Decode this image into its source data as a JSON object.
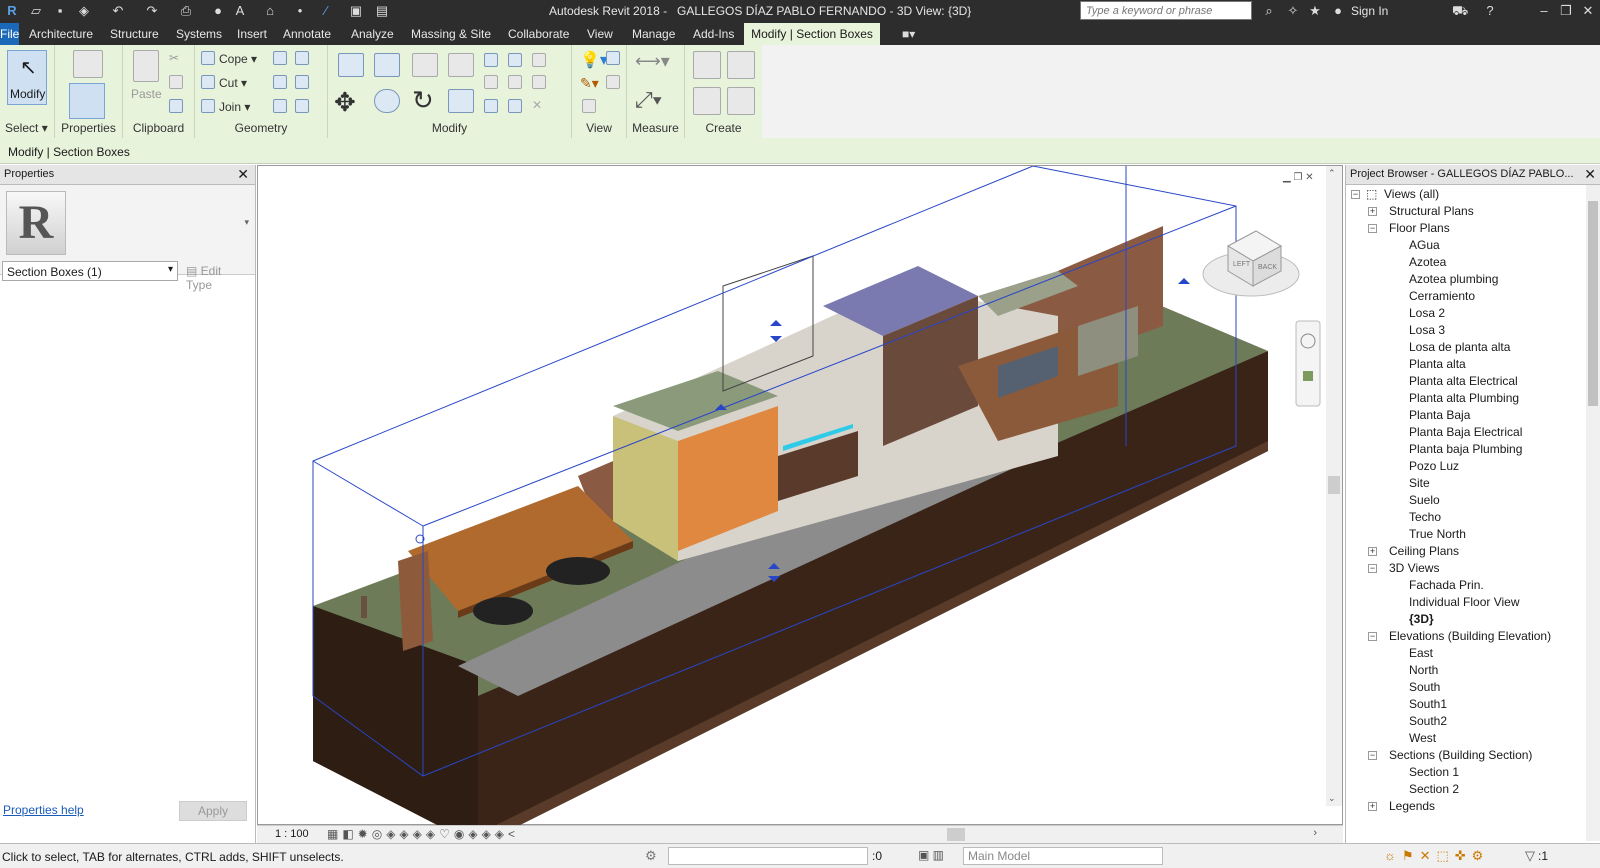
{
  "title": {
    "app": "Autodesk Revit 2018 -",
    "doc": "GALLEGOS DÍAZ PABLO FERNANDO - 3D View: {3D}",
    "search_placeholder": "Type a keyword or phrase",
    "sign_in": "Sign In"
  },
  "menu": {
    "tabs": [
      "File",
      "Architecture",
      "Structure",
      "Systems",
      "Insert",
      "Annotate",
      "Analyze",
      "Massing & Site",
      "Collaborate",
      "View",
      "Manage",
      "Add-Ins",
      "Modify | Section Boxes"
    ]
  },
  "ribbon": {
    "modify": "Modify",
    "properties": "Properties",
    "paste": "Paste",
    "cope": "Cope",
    "cut": "Cut",
    "join": "Join",
    "panels": {
      "select": "Select",
      "properties": "Properties",
      "clipboard": "Clipboard",
      "geometry": "Geometry",
      "modify": "Modify",
      "view": "View",
      "measure": "Measure",
      "create": "Create"
    }
  },
  "options_bar": "Modify | Section Boxes",
  "properties_panel": {
    "header": "Properties",
    "selector": "Section Boxes (1)",
    "edit_type": "Edit Type",
    "help": "Properties help",
    "apply": "Apply",
    "logo": "R"
  },
  "view": {
    "scale": "1 : 100",
    "viewcube": {
      "left": "LEFT",
      "back": "BACK"
    }
  },
  "project_browser": {
    "header": "Project Browser - GALLEGOS DÍAZ PABLO...",
    "root": "Views (all)",
    "groups": [
      {
        "label": "Structural Plans",
        "expanded": false,
        "items": []
      },
      {
        "label": "Floor Plans",
        "expanded": true,
        "items": [
          "AGua",
          "Azotea",
          "Azotea plumbing",
          "Cerramiento",
          "Losa 2",
          "Losa 3",
          "Losa de planta alta",
          "Planta alta",
          "Planta alta Electrical",
          "Planta alta Plumbing",
          "Planta Baja",
          "Planta Baja Electrical",
          "Planta baja Plumbing",
          "Pozo Luz",
          "Site",
          "Suelo",
          "Techo",
          "True North"
        ]
      },
      {
        "label": "Ceiling Plans",
        "expanded": false,
        "items": []
      },
      {
        "label": "3D Views",
        "expanded": true,
        "items": [
          "Fachada Prin.",
          "Individual Floor View",
          "{3D}"
        ]
      },
      {
        "label": "Elevations (Building Elevation)",
        "expanded": true,
        "items": [
          "East",
          "North",
          "South",
          "South1",
          "South2",
          "West"
        ]
      },
      {
        "label": "Sections (Building Section)",
        "expanded": true,
        "items": [
          "Section 1",
          "Section 2"
        ]
      },
      {
        "label": "Legends",
        "expanded": false,
        "items": []
      }
    ]
  },
  "status": {
    "message": "Click to select, TAB for alternates, CTRL adds, SHIFT unselects.",
    "filter_count": ":0",
    "main_model": "Main Model",
    "selection_count": ":1"
  }
}
